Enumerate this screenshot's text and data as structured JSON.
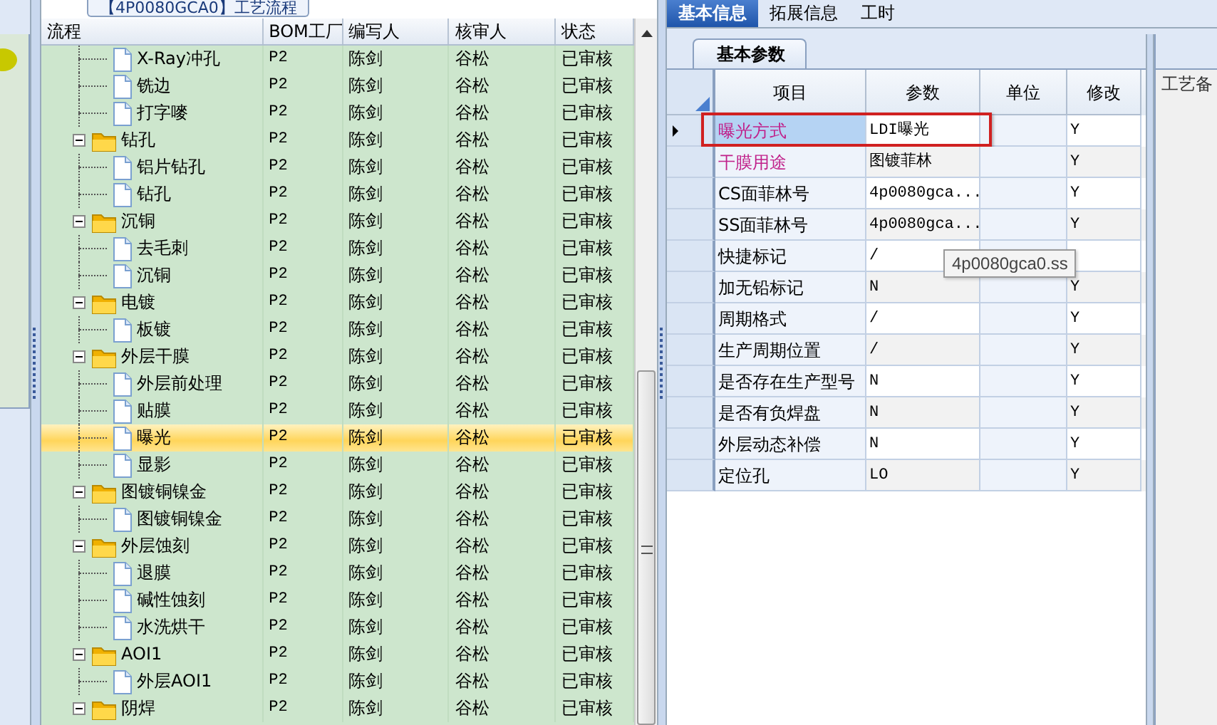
{
  "left_tab": {
    "title": "【4P0080GCA0】工艺流程"
  },
  "process_grid": {
    "columns": [
      "流程",
      "BOM工厂",
      "编写人",
      "核审人",
      "状态"
    ],
    "tree": [
      {
        "children": [
          {
            "name": "X-Ray冲孔",
            "bom": "P2",
            "writer": "陈剑",
            "reviewer": "谷松",
            "status": "已审核",
            "selected": false
          },
          {
            "name": "铣边",
            "bom": "P2",
            "writer": "陈剑",
            "reviewer": "谷松",
            "status": "已审核",
            "selected": false
          },
          {
            "name": "打字嘜",
            "bom": "P2",
            "writer": "陈剑",
            "reviewer": "谷松",
            "status": "已审核",
            "selected": false
          }
        ]
      },
      {
        "name": "钻孔",
        "bom": "P2",
        "writer": "陈剑",
        "reviewer": "谷松",
        "status": "已审核",
        "selected": false,
        "expanded": true,
        "children": [
          {
            "name": "铝片钻孔",
            "bom": "P2",
            "writer": "陈剑",
            "reviewer": "谷松",
            "status": "已审核",
            "selected": false
          },
          {
            "name": "钻孔",
            "bom": "P2",
            "writer": "陈剑",
            "reviewer": "谷松",
            "status": "已审核",
            "selected": false
          }
        ]
      },
      {
        "name": "沉铜",
        "bom": "P2",
        "writer": "陈剑",
        "reviewer": "谷松",
        "status": "已审核",
        "selected": false,
        "expanded": true,
        "children": [
          {
            "name": "去毛刺",
            "bom": "P2",
            "writer": "陈剑",
            "reviewer": "谷松",
            "status": "已审核",
            "selected": false
          },
          {
            "name": "沉铜",
            "bom": "P2",
            "writer": "陈剑",
            "reviewer": "谷松",
            "status": "已审核",
            "selected": false
          }
        ]
      },
      {
        "name": "电镀",
        "bom": "P2",
        "writer": "陈剑",
        "reviewer": "谷松",
        "status": "已审核",
        "selected": false,
        "expanded": true,
        "children": [
          {
            "name": "板镀",
            "bom": "P2",
            "writer": "陈剑",
            "reviewer": "谷松",
            "status": "已审核",
            "selected": false
          }
        ]
      },
      {
        "name": "外层干膜",
        "bom": "P2",
        "writer": "陈剑",
        "reviewer": "谷松",
        "status": "已审核",
        "selected": false,
        "expanded": true,
        "children": [
          {
            "name": "外层前处理",
            "bom": "P2",
            "writer": "陈剑",
            "reviewer": "谷松",
            "status": "已审核",
            "selected": false
          },
          {
            "name": "贴膜",
            "bom": "P2",
            "writer": "陈剑",
            "reviewer": "谷松",
            "status": "已审核",
            "selected": false
          },
          {
            "name": "曝光",
            "bom": "P2",
            "writer": "陈剑",
            "reviewer": "谷松",
            "status": "已审核",
            "selected": true
          },
          {
            "name": "显影",
            "bom": "P2",
            "writer": "陈剑",
            "reviewer": "谷松",
            "status": "已审核",
            "selected": false
          }
        ]
      },
      {
        "name": "图镀铜镍金",
        "bom": "P2",
        "writer": "陈剑",
        "reviewer": "谷松",
        "status": "已审核",
        "selected": false,
        "expanded": true,
        "children": [
          {
            "name": "图镀铜镍金",
            "bom": "P2",
            "writer": "陈剑",
            "reviewer": "谷松",
            "status": "已审核",
            "selected": false
          }
        ]
      },
      {
        "name": "外层蚀刻",
        "bom": "P2",
        "writer": "陈剑",
        "reviewer": "谷松",
        "status": "已审核",
        "selected": false,
        "expanded": true,
        "children": [
          {
            "name": "退膜",
            "bom": "P2",
            "writer": "陈剑",
            "reviewer": "谷松",
            "status": "已审核",
            "selected": false
          },
          {
            "name": "碱性蚀刻",
            "bom": "P2",
            "writer": "陈剑",
            "reviewer": "谷松",
            "status": "已审核",
            "selected": false
          },
          {
            "name": "水洗烘干",
            "bom": "P2",
            "writer": "陈剑",
            "reviewer": "谷松",
            "status": "已审核",
            "selected": false
          }
        ]
      },
      {
        "name": "AOI1",
        "bom": "P2",
        "writer": "陈剑",
        "reviewer": "谷松",
        "status": "已审核",
        "selected": false,
        "expanded": true,
        "children": [
          {
            "name": "外层AOI1",
            "bom": "P2",
            "writer": "陈剑",
            "reviewer": "谷松",
            "status": "已审核",
            "selected": false
          }
        ]
      },
      {
        "name": "阴焊",
        "bom": "P2",
        "writer": "陈剑",
        "reviewer": "谷松",
        "status": "已审核",
        "selected": false,
        "expanded": true
      }
    ]
  },
  "tabs": [
    {
      "label": "基本信息",
      "selected": true
    },
    {
      "label": "拓展信息",
      "selected": false
    },
    {
      "label": "工时",
      "selected": false
    }
  ],
  "sub_tab": {
    "label": "基本参数"
  },
  "param_grid": {
    "columns": [
      "项目",
      "参数",
      "单位",
      "修改"
    ],
    "rows": [
      {
        "item": "曝光方式",
        "param": "LDI曝光",
        "unit": "",
        "modify": "Y",
        "selected": true,
        "emphasized": true,
        "outlined": true
      },
      {
        "item": "干膜用途",
        "param": "图镀菲林",
        "unit": "",
        "modify": "Y",
        "selected": false,
        "emphasized": true,
        "outlined": false
      },
      {
        "item": "CS面菲林号",
        "param": "4p0080gca...",
        "unit": "",
        "modify": "Y",
        "selected": false,
        "emphasized": false,
        "outlined": false
      },
      {
        "item": "SS面菲林号",
        "param": "4p0080gca...",
        "unit": "",
        "modify": "Y",
        "selected": false,
        "emphasized": false,
        "outlined": false
      },
      {
        "item": "快捷标记",
        "param": "/",
        "unit": "",
        "modify": "",
        "selected": false,
        "emphasized": false,
        "outlined": false
      },
      {
        "item": "加无铅标记",
        "param": "N",
        "unit": "",
        "modify": "Y",
        "selected": false,
        "emphasized": false,
        "outlined": false
      },
      {
        "item": "周期格式",
        "param": "/",
        "unit": "",
        "modify": "Y",
        "selected": false,
        "emphasized": false,
        "outlined": false
      },
      {
        "item": "生产周期位置",
        "param": "/",
        "unit": "",
        "modify": "Y",
        "selected": false,
        "emphasized": false,
        "outlined": false
      },
      {
        "item": "是否存在生产型号",
        "param": "N",
        "unit": "",
        "modify": "Y",
        "selected": false,
        "emphasized": false,
        "outlined": false
      },
      {
        "item": "是否有负焊盘",
        "param": "N",
        "unit": "",
        "modify": "Y",
        "selected": false,
        "emphasized": false,
        "outlined": false
      },
      {
        "item": "外层动态补偿",
        "param": "N",
        "unit": "",
        "modify": "Y",
        "selected": false,
        "emphasized": false,
        "outlined": false
      },
      {
        "item": "定位孔",
        "param": "LO",
        "unit": "",
        "modify": "Y",
        "selected": false,
        "emphasized": false,
        "outlined": false
      }
    ]
  },
  "tooltip": {
    "text": "4p0080gca0.ss"
  },
  "side_panel": {
    "label": "工艺备"
  }
}
